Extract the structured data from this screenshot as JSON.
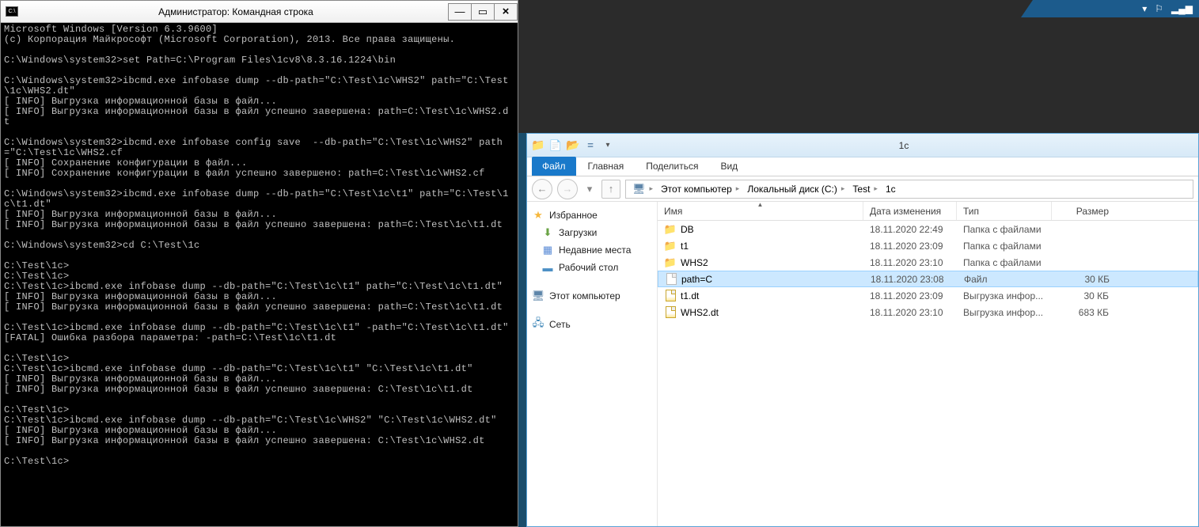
{
  "cmd": {
    "title": "Администратор: Командная строка",
    "icon_text": "C:\\",
    "output": "Microsoft Windows [Version 6.3.9600]\n(c) Корпорация Майкрософт (Microsoft Corporation), 2013. Все права защищены.\n\nC:\\Windows\\system32>set Path=C:\\Program Files\\1cv8\\8.3.16.1224\\bin\n\nC:\\Windows\\system32>ibcmd.exe infobase dump --db-path=\"C:\\Test\\1c\\WHS2\" path=\"C:\\Test\\1c\\WHS2.dt\"\n[ INFO] Выгрузка информационной базы в файл...\n[ INFO] Выгрузка информационной базы в файл успешно завершена: path=C:\\Test\\1c\\WHS2.dt\n\nC:\\Windows\\system32>ibcmd.exe infobase config save  --db-path=\"C:\\Test\\1c\\WHS2\" path=\"C:\\Test\\1c\\WHS2.cf\n[ INFO] Сохранение конфигурации в файл...\n[ INFO] Сохранение конфигурации в файл успешно завершено: path=C:\\Test\\1c\\WHS2.cf\n\nC:\\Windows\\system32>ibcmd.exe infobase dump --db-path=\"C:\\Test\\1c\\t1\" path=\"C:\\Test\\1c\\t1.dt\"\n[ INFO] Выгрузка информационной базы в файл...\n[ INFO] Выгрузка информационной базы в файл успешно завершена: path=C:\\Test\\1c\\t1.dt\n\nC:\\Windows\\system32>cd C:\\Test\\1c\n\nC:\\Test\\1c>\nC:\\Test\\1c>\nC:\\Test\\1c>ibcmd.exe infobase dump --db-path=\"C:\\Test\\1c\\t1\" path=\"C:\\Test\\1c\\t1.dt\"\n[ INFO] Выгрузка информационной базы в файл...\n[ INFO] Выгрузка информационной базы в файл успешно завершена: path=C:\\Test\\1c\\t1.dt\n\nC:\\Test\\1c>ibcmd.exe infobase dump --db-path=\"C:\\Test\\1c\\t1\" -path=\"C:\\Test\\1c\\t1.dt\"\n[FATAL] Ошибка разбора параметра: -path=C:\\Test\\1c\\t1.dt\n\nC:\\Test\\1c>\nC:\\Test\\1c>ibcmd.exe infobase dump --db-path=\"C:\\Test\\1c\\t1\" \"C:\\Test\\1c\\t1.dt\"\n[ INFO] Выгрузка информационной базы в файл...\n[ INFO] Выгрузка информационной базы в файл успешно завершена: C:\\Test\\1c\\t1.dt\n\nC:\\Test\\1c>\nC:\\Test\\1c>ibcmd.exe infobase dump --db-path=\"C:\\Test\\1c\\WHS2\" \"C:\\Test\\1c\\WHS2.dt\"\n[ INFO] Выгрузка информационной базы в файл...\n[ INFO] Выгрузка информационной базы в файл успешно завершена: C:\\Test\\1c\\WHS2.dt\n\nC:\\Test\\1c>"
  },
  "explorer": {
    "title": "1c",
    "ribbon": {
      "tabs": [
        "Файл",
        "Главная",
        "Поделиться",
        "Вид"
      ],
      "active_index": 0
    },
    "breadcrumb": [
      "Этот компьютер",
      "Локальный диск (C:)",
      "Test",
      "1c"
    ],
    "sidebar": {
      "favorites": {
        "label": "Избранное",
        "items": [
          "Загрузки",
          "Недавние места",
          "Рабочий стол"
        ]
      },
      "computer": {
        "label": "Этот компьютер"
      },
      "network": {
        "label": "Сеть"
      }
    },
    "columns": {
      "name": "Имя",
      "date": "Дата изменения",
      "type": "Тип",
      "size": "Размер"
    },
    "files": [
      {
        "icon": "folder",
        "name": "DB",
        "date": "18.11.2020 22:49",
        "type": "Папка с файлами",
        "size": ""
      },
      {
        "icon": "folder",
        "name": "t1",
        "date": "18.11.2020 23:09",
        "type": "Папка с файлами",
        "size": ""
      },
      {
        "icon": "folder",
        "name": "WHS2",
        "date": "18.11.2020 23:10",
        "type": "Папка с файлами",
        "size": ""
      },
      {
        "icon": "file",
        "name": "path=C",
        "date": "18.11.2020 23:08",
        "type": "Файл",
        "size": "30 КБ",
        "selected": true
      },
      {
        "icon": "dt",
        "name": "t1.dt",
        "date": "18.11.2020 23:09",
        "type": "Выгрузка инфор...",
        "size": "30 КБ"
      },
      {
        "icon": "dt",
        "name": "WHS2.dt",
        "date": "18.11.2020 23:10",
        "type": "Выгрузка инфор...",
        "size": "683 КБ"
      }
    ]
  },
  "tray": {
    "sound_level": "▂▄▆"
  }
}
